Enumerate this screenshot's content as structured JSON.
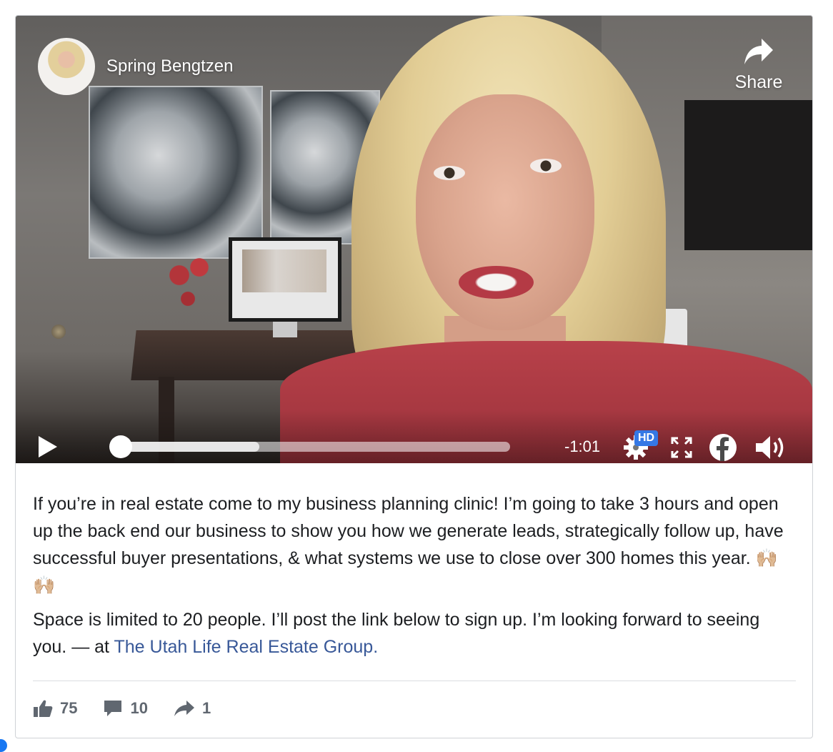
{
  "video": {
    "channel_name": "Spring Bengtzen",
    "share_label": "Share",
    "time_remaining": "-1:01",
    "quality_badge": "HD",
    "progress_played": 0.0,
    "progress_buffered": 0.37
  },
  "post": {
    "paragraph1": "If you’re in real estate come to my business planning clinic! I’m going to take 3 hours and open up the back end our business to show you how we generate leads, strategically follow up, have successful buyer presentations, & what systems we use to close over 300 homes this year. 🙌🏼🙌🏼",
    "paragraph2_prefix": "Space is limited to 20 people. I’ll post the link below to sign up. I’m looking forward to seeing you. — at ",
    "location_link": "The Utah Life Real Estate Group",
    "paragraph2_suffix": "."
  },
  "stats": {
    "likes": "75",
    "comments": "10",
    "shares": "1"
  },
  "icons": [
    "play-icon",
    "share-arrow-icon",
    "settings-gear-icon",
    "fullscreen-icon",
    "facebook-icon",
    "volume-icon",
    "like-icon",
    "comment-icon",
    "share-icon"
  ],
  "colors": {
    "link": "#385898",
    "hd_badge": "#3578e5",
    "text": "#1c1e21",
    "muted": "#606770"
  }
}
